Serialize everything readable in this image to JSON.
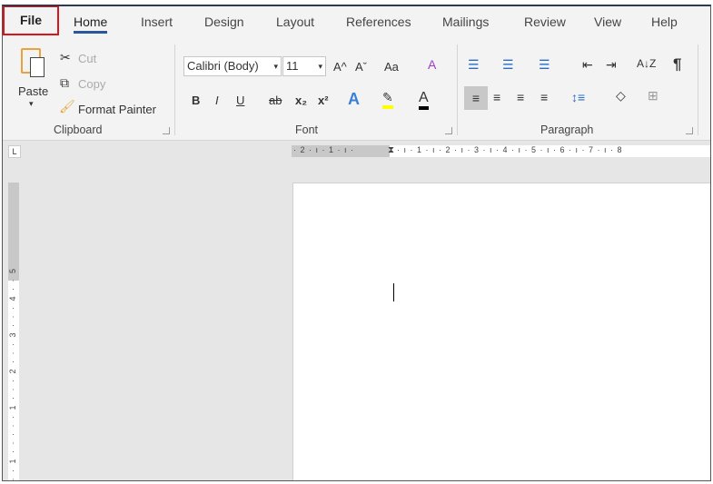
{
  "tabs": [
    "File",
    "Home",
    "Insert",
    "Design",
    "Layout",
    "References",
    "Mailings",
    "Review",
    "View",
    "Help"
  ],
  "clipboard": {
    "paste": "Paste",
    "cut": "Cut",
    "copy": "Copy",
    "format_painter": "Format Painter",
    "label": "Clipboard"
  },
  "font": {
    "name": "Calibri (Body)",
    "size": "11",
    "label": "Font",
    "bold": "B",
    "italic": "I",
    "underline": "U",
    "strike": "ab",
    "sub": "x₂",
    "sup": "x²",
    "change_case": "Aa",
    "grow": "A^",
    "shrink": "Aˇ",
    "effects": "A",
    "font_color": "A"
  },
  "paragraph": {
    "label": "Paragraph",
    "pilcrow": "¶",
    "sort": "A↓Z"
  },
  "ruler": {
    "left": "· 2 · ı · 1 · ı ·",
    "right": "· ı · 1 · ı · 2 · ı · 3 · ı · 4 · ı · 5 · ı · 6 · ı · 7 · ı · 8"
  },
  "vruler": "2 · · 1 · · · · · 1 · · · 2 · · · 3 · · · 4 · · 5",
  "colors": {
    "accent": "#2b579a",
    "file_highlight": "#d9151b",
    "highlight": "#ffff00"
  }
}
